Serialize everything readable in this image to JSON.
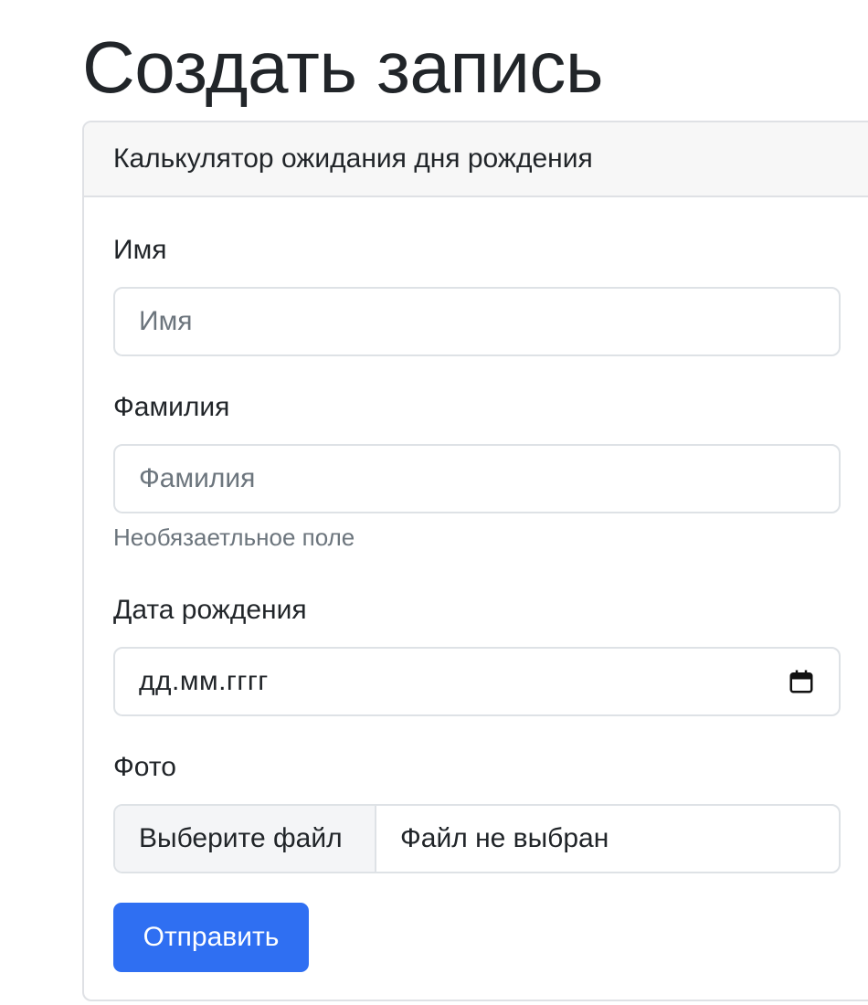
{
  "page": {
    "title": "Создать запись"
  },
  "card": {
    "header": "Калькулятор ожидания дня рождения"
  },
  "form": {
    "first_name": {
      "label": "Имя",
      "placeholder": "Имя",
      "value": ""
    },
    "last_name": {
      "label": "Фамилия",
      "placeholder": "Фамилия",
      "value": "",
      "help_text": "Необязаетльное поле"
    },
    "birth_date": {
      "label": "Дата рождения",
      "display_value": "дд.мм.гггг",
      "icon": "calendar-icon"
    },
    "photo": {
      "label": "Фото",
      "button_label": "Выберите файл",
      "status": "Файл не выбран"
    },
    "submit_label": "Отправить"
  },
  "colors": {
    "primary": "#2f6ff2",
    "border": "#dee2e6",
    "header_bg": "#f7f7f7",
    "muted_text": "#6c757d",
    "text": "#212529"
  }
}
